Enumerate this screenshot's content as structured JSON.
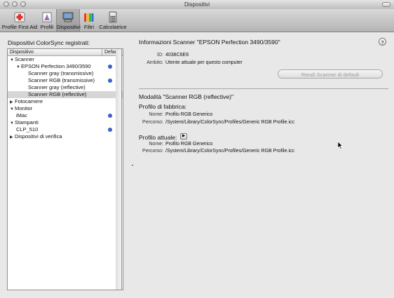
{
  "window": {
    "title": "Dispositivi"
  },
  "toolbar": {
    "items": [
      {
        "label": "Profile First Aid",
        "icon": "first-aid-icon"
      },
      {
        "label": "Profili",
        "icon": "profiles-icon"
      },
      {
        "label": "Dispositivi",
        "icon": "devices-icon",
        "selected": true
      },
      {
        "label": "Filtri",
        "icon": "filters-icon"
      },
      {
        "label": "Calcolatrice",
        "icon": "calculator-icon"
      }
    ]
  },
  "left": {
    "title": "Dispositivi ColorSync registrati:",
    "columns": {
      "device": "Dispositivo",
      "default": "Default"
    },
    "rows": [
      {
        "label": "Scanner",
        "level": 0,
        "expander": "open",
        "default": false
      },
      {
        "label": "EPSON Perfection 3490/3590",
        "level": 1,
        "expander": "open",
        "default": true
      },
      {
        "label": "Scanner gray (transmissive)",
        "level": 2,
        "expander": "",
        "default": false
      },
      {
        "label": "Scanner RGB (transmissive)",
        "level": 2,
        "expander": "",
        "default": true
      },
      {
        "label": "Scanner gray (reflective)",
        "level": 2,
        "expander": "",
        "default": false
      },
      {
        "label": "Scanner RGB (reflective)",
        "level": 2,
        "expander": "",
        "default": false,
        "selected": true
      },
      {
        "label": "Fotocamere",
        "level": 0,
        "expander": "closed",
        "default": false
      },
      {
        "label": "Monitor",
        "level": 0,
        "expander": "open",
        "default": false
      },
      {
        "label": "iMac",
        "level": 1,
        "expander": "",
        "default": true
      },
      {
        "label": "Stampanti",
        "level": 0,
        "expander": "open",
        "default": false
      },
      {
        "label": "CLP_510",
        "level": 1,
        "expander": "",
        "default": true
      },
      {
        "label": "Dispositivi di verifica",
        "level": 0,
        "expander": "closed",
        "default": false
      }
    ]
  },
  "right": {
    "info_title": "Informazioni Scanner \"EPSON Perfection 3490/3590\"",
    "help": "?",
    "id_label": "ID:",
    "id_value": "4038C6E6",
    "scope_label": "Ambito:",
    "scope_value": "Utente attuale per questo computer",
    "default_button": "Rendi Scanner di default",
    "mode_title": "Modalità \"Scanner RGB (reflective)\"",
    "factory_title": "Profilo di fabbrica:",
    "name_label": "Nome:",
    "path_label": "Percorso:",
    "factory_name": "Profilo RGB Generico",
    "factory_path": "/System/Library/ColorSync/Profiles/Generic RGB Profile.icc",
    "current_title": "Profilo attuale:",
    "current_name": "Profilo RGB Generico",
    "current_path": "/System/Library/ColorSync/Profiles/Generic RGB Profile.icc"
  }
}
